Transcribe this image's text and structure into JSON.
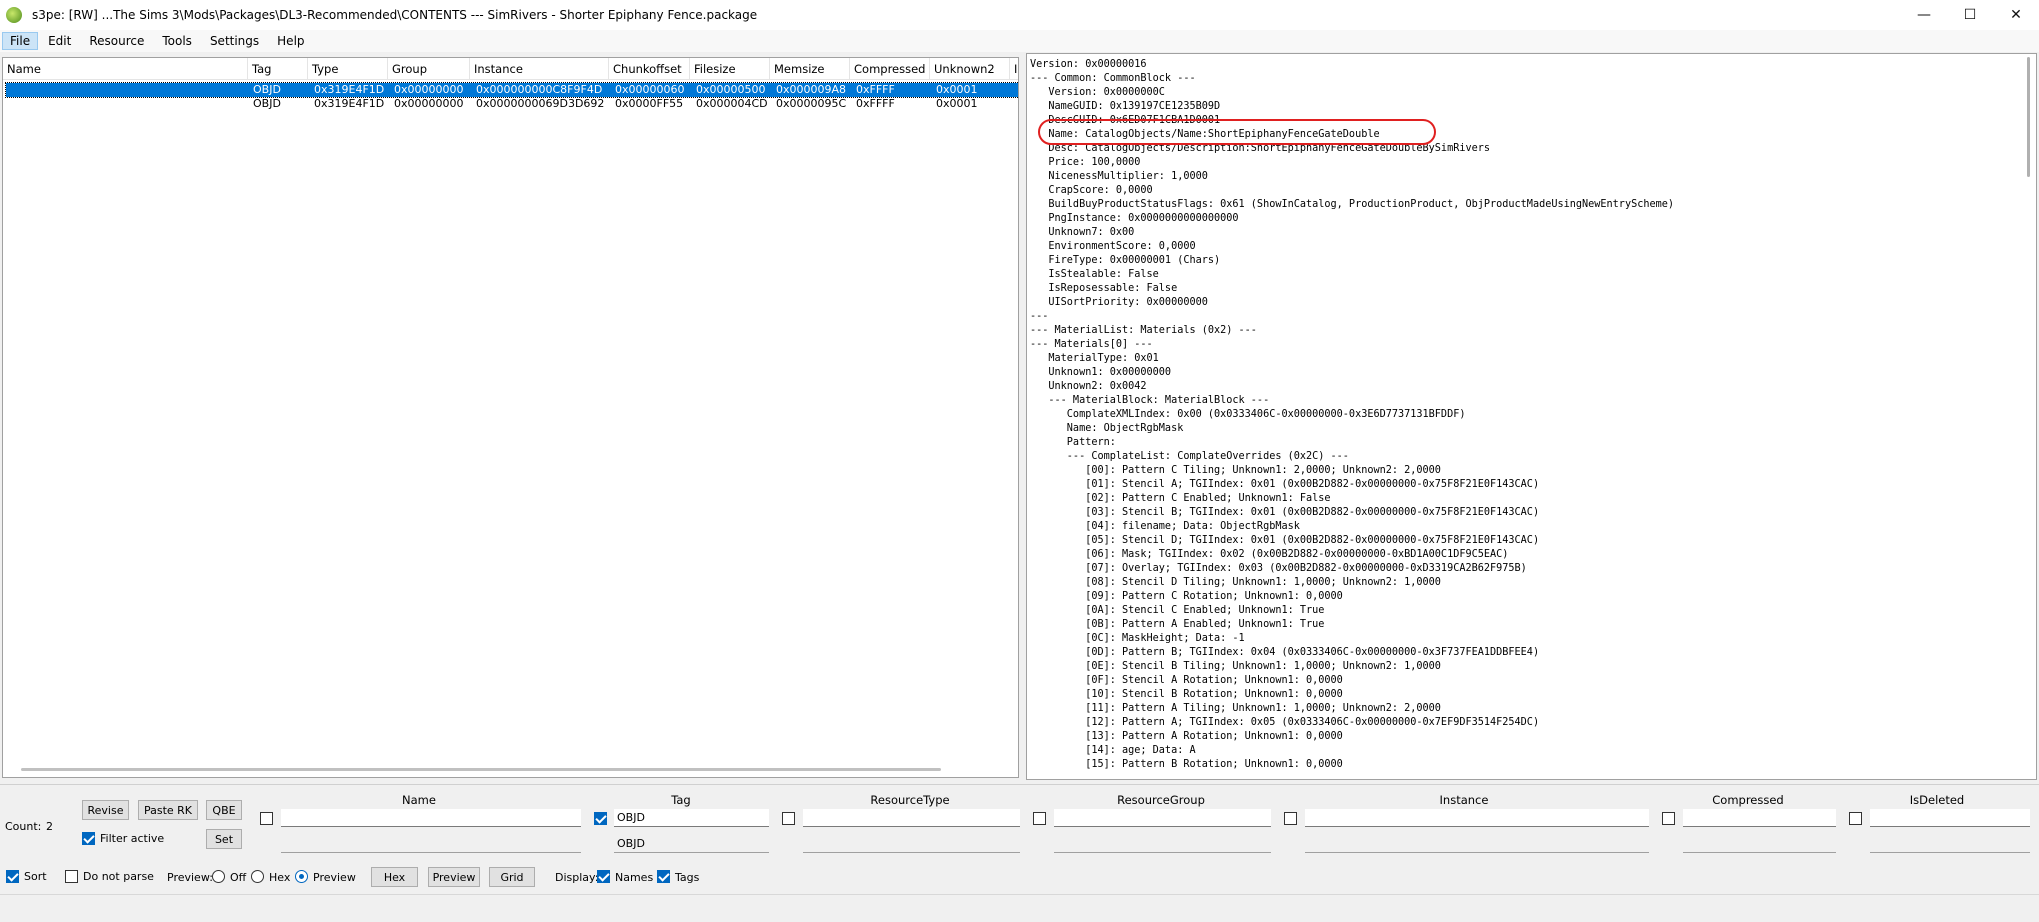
{
  "window": {
    "title": "s3pe: [RW] ...The Sims 3\\Mods\\Packages\\DL3-Recommended\\CONTENTS --- SimRivers - Shorter Epiphany Fence.package",
    "minimize": "—",
    "maximize": "☐",
    "close": "✕"
  },
  "menu": [
    "File",
    "Edit",
    "Resource",
    "Tools",
    "Settings",
    "Help"
  ],
  "list": {
    "columns": [
      "Name",
      "Tag",
      "Type",
      "Group",
      "Instance",
      "Chunkoffset",
      "Filesize",
      "Memsize",
      "Compressed",
      "Unknown2",
      "I"
    ],
    "rows": [
      [
        "",
        "OBJD",
        "0x319E4F1D",
        "0x00000000",
        "0x000000000C8F9F4D",
        "0x00000060",
        "0x00000500",
        "0x000009A8",
        "0xFFFF",
        "0x0001"
      ],
      [
        "",
        "OBJD",
        "0x319E4F1D",
        "0x00000000",
        "0x0000000069D3D692",
        "0x0000FF55",
        "0x000004CD",
        "0x0000095C",
        "0xFFFF",
        "0x0001"
      ]
    ]
  },
  "preview": {
    "lines": [
      "Version: 0x00000016",
      "--- Common: CommonBlock ---",
      "   Version: 0x0000000C",
      "   NameGUID: 0x139197CE1235B09D",
      "   DescGUID: 0x6ED07F1CBA1D0001",
      "   Name: CatalogObjects/Name:ShortEpiphanyFenceGateDouble",
      "   Desc: CatalogObjects/Description:ShortEpiphanyFenceGateDoubleBySimRivers",
      "   Price: 100,0000",
      "   NicenessMultiplier: 1,0000",
      "   CrapScore: 0,0000",
      "   BuildBuyProductStatusFlags: 0x61 (ShowInCatalog, ProductionProduct, ObjProductMadeUsingNewEntryScheme)",
      "   PngInstance: 0x0000000000000000",
      "   Unknown7: 0x00",
      "   EnvironmentScore: 0,0000",
      "   FireType: 0x00000001 (Chars)",
      "   IsStealable: False",
      "   IsReposessable: False",
      "   UISortPriority: 0x00000000",
      "---",
      "--- MaterialList: Materials (0x2) ---",
      "--- Materials[0] ---",
      "   MaterialType: 0x01",
      "   Unknown1: 0x00000000",
      "   Unknown2: 0x0042",
      "   --- MaterialBlock: MaterialBlock ---",
      "      ComplateXMLIndex: 0x00 (0x0333406C-0x00000000-0x3E6D7737131BFDDF)",
      "      Name: ObjectRgbMask",
      "      Pattern:",
      "      --- ComplateList: ComplateOverrides (0x2C) ---",
      "         [00]: Pattern C Tiling; Unknown1: 2,0000; Unknown2: 2,0000",
      "         [01]: Stencil A; TGIIndex: 0x01 (0x00B2D882-0x00000000-0x75F8F21E0F143CAC)",
      "         [02]: Pattern C Enabled; Unknown1: False",
      "         [03]: Stencil B; TGIIndex: 0x01 (0x00B2D882-0x00000000-0x75F8F21E0F143CAC)",
      "         [04]: filename; Data: ObjectRgbMask",
      "         [05]: Stencil D; TGIIndex: 0x01 (0x00B2D882-0x00000000-0x75F8F21E0F143CAC)",
      "         [06]: Mask; TGIIndex: 0x02 (0x00B2D882-0x00000000-0xBD1A00C1DF9C5EAC)",
      "         [07]: Overlay; TGIIndex: 0x03 (0x00B2D882-0x00000000-0xD3319CA2B62F975B)",
      "         [08]: Stencil D Tiling; Unknown1: 1,0000; Unknown2: 1,0000",
      "         [09]: Pattern C Rotation; Unknown1: 0,0000",
      "         [0A]: Stencil C Enabled; Unknown1: True",
      "         [0B]: Pattern A Enabled; Unknown1: True",
      "         [0C]: MaskHeight; Data: -1",
      "         [0D]: Pattern B; TGIIndex: 0x04 (0x0333406C-0x00000000-0x3F737FEA1DDBFEE4)",
      "         [0E]: Stencil B Tiling; Unknown1: 1,0000; Unknown2: 1,0000",
      "         [0F]: Stencil A Rotation; Unknown1: 0,0000",
      "         [10]: Stencil B Rotation; Unknown1: 0,0000",
      "         [11]: Pattern A Tiling; Unknown1: 1,0000; Unknown2: 2,0000",
      "         [12]: Pattern A; TGIIndex: 0x05 (0x0333406C-0x00000000-0x7EF9DF3514F254DC)",
      "         [13]: Pattern A Rotation; Unknown1: 0,0000",
      "         [14]: age; Data: A",
      "         [15]: Pattern B Rotation; Unknown1: 0,0000"
    ]
  },
  "filter": {
    "count_label": "Count:",
    "count_value": "2",
    "revise": "Revise",
    "paste_rk": "Paste RK",
    "qbe": "QBE",
    "filter_active": "Filter active",
    "set": "Set",
    "columns": [
      "Name",
      "Tag",
      "ResourceType",
      "ResourceGroup",
      "Instance",
      "Compressed",
      "IsDeleted"
    ],
    "tag_value": "OBJD",
    "tag_value2": "OBJD"
  },
  "options": {
    "sort": "Sort",
    "do_not_parse": "Do not parse",
    "preview_label": "Preview:",
    "off": "Off",
    "hex": "Hex",
    "preview": "Preview",
    "hex_button": "Hex",
    "preview_button": "Preview",
    "grid_button": "Grid",
    "display_label": "Display:",
    "names": "Names",
    "tags": "Tags"
  }
}
